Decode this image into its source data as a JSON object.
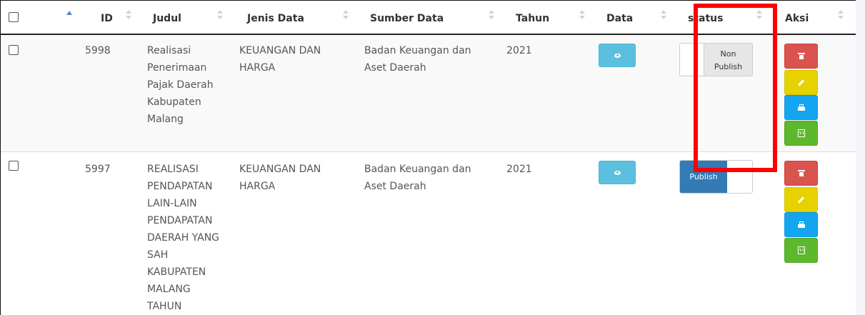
{
  "table": {
    "columns": {
      "id": "ID",
      "judul": "Judul",
      "jenis": "Jenis Data",
      "sumber": "Sumber Data",
      "tahun": "Tahun",
      "data": "Data",
      "status": "status",
      "aksi": "Aksi"
    },
    "rows": [
      {
        "id": "5998",
        "judul_lines": [
          "Realisasi",
          "Penerimaan",
          "Pajak Daerah",
          "Kabupaten",
          "Malang"
        ],
        "jenis_lines": [
          "KEUANGAN DAN",
          "HARGA"
        ],
        "sumber_lines": [
          "Badan Keuangan dan",
          "Aset Daerah"
        ],
        "tahun": "2021",
        "status_label_lines": [
          "Non",
          "Publish"
        ]
      },
      {
        "id": "5997",
        "judul_lines": [
          "REALISASI",
          "PENDAPATAN",
          "LAIN-LAIN",
          "PENDAPATAN",
          "DAERAH YANG",
          "SAH",
          "KABUPATEN",
          "MALANG",
          "TAHUN"
        ],
        "jenis_lines": [
          "KEUANGAN DAN",
          "HARGA"
        ],
        "sumber_lines": [
          "Badan Keuangan dan",
          "Aset Daerah"
        ],
        "tahun": "2021",
        "status_label": "Publish"
      }
    ]
  },
  "icons": {
    "view": "eye-icon",
    "delete": "trash-icon",
    "edit": "pencil-icon",
    "print": "print-icon",
    "export": "excel-icon"
  },
  "colors": {
    "info": "#5bc0de",
    "danger": "#d9534f",
    "warning": "#e6d200",
    "primary_light": "#13a5f0",
    "success": "#5cb82c",
    "toggle_on": "#337ab7",
    "highlight": "#ff0000"
  }
}
